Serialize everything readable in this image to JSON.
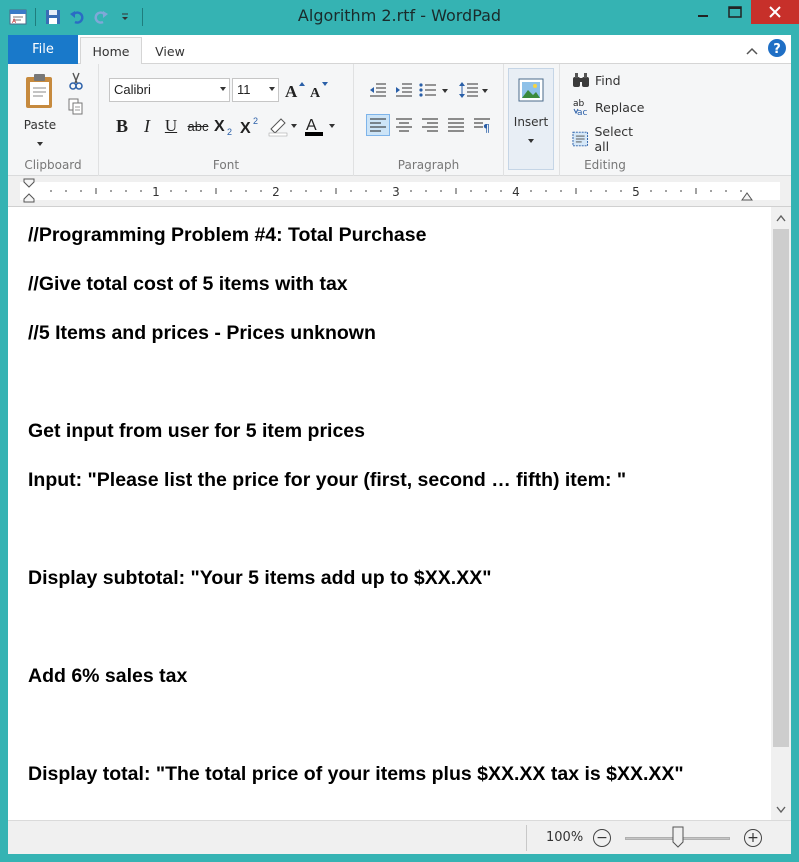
{
  "window": {
    "title": "Algorithm 2.rtf - WordPad"
  },
  "tabs": {
    "file": "File",
    "home": "Home",
    "view": "View"
  },
  "clipboard": {
    "paste": "Paste",
    "label": "Clipboard"
  },
  "font": {
    "family": "Calibri",
    "size": "11",
    "label": "Font",
    "bold": "B",
    "italic": "I",
    "underline": "U",
    "strike": "abc"
  },
  "paragraph": {
    "label": "Paragraph"
  },
  "insert": {
    "label": "Insert"
  },
  "editing": {
    "find": "Find",
    "replace": "Replace",
    "select_all": "Select all",
    "label": "Editing"
  },
  "ruler": {
    "numbers": [
      "1",
      "2",
      "3",
      "4",
      "5"
    ]
  },
  "document": {
    "lines": [
      "//Programming Problem #4: Total Purchase",
      "//Give total cost of 5 items with tax",
      "//5 Items and prices - Prices unknown",
      "",
      "Get input from user for 5 item prices",
      "Input: \"Please list the price for your (first, second … fifth) item: \"",
      "",
      "Display subtotal: \"Your 5 items add up to $XX.XX\"",
      "",
      "Add 6% sales tax",
      "",
      "Display total: \"The total price of your items plus $XX.XX tax is $XX.XX\""
    ]
  },
  "status": {
    "zoom": "100%",
    "zoom_level": 100
  },
  "colors": {
    "frame": "#35b3b3",
    "file_tab": "#1979ca",
    "close": "#c7302a"
  }
}
